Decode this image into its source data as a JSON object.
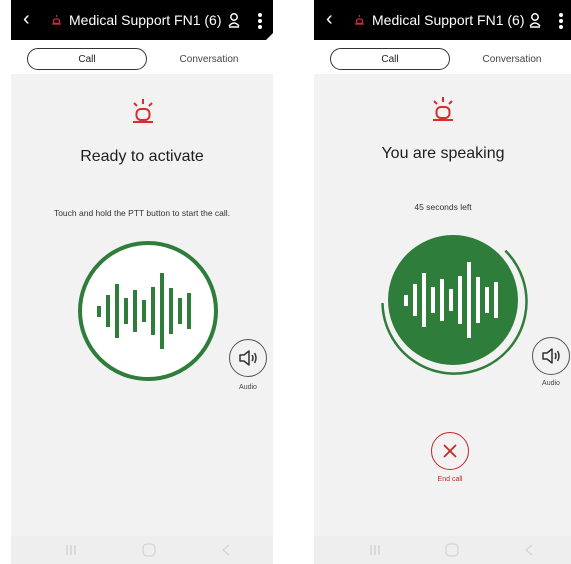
{
  "colors": {
    "accent_green": "#2e7d3a",
    "alert_red": "#d32f2f",
    "titlebar_bg": "#000000"
  },
  "left_screen": {
    "header": {
      "back_icon": "chevron-left-icon",
      "group_icon": "siren-icon",
      "title": "Medical Support FN1 (6)",
      "contact_icon": "contact-icon",
      "menu_icon": "more-vert-icon"
    },
    "tabs": [
      {
        "label": "Call",
        "active": true
      },
      {
        "label": "Conversation",
        "active": false
      }
    ],
    "status_icon": "siren-icon",
    "status_title": "Ready to activate",
    "hint": "Touch and hold the PTT button to start the call.",
    "ptt_button": {
      "icon": "waveform-icon",
      "state": "idle"
    },
    "audio": {
      "icon": "speaker-icon",
      "label": "Audio"
    },
    "navbar": [
      "recent-apps-icon",
      "home-icon",
      "back-icon"
    ]
  },
  "right_screen": {
    "header": {
      "back_icon": "chevron-left-icon",
      "group_icon": "siren-icon",
      "title": "Medical Support FN1 (6)",
      "contact_icon": "contact-icon",
      "menu_icon": "more-vert-icon"
    },
    "tabs": [
      {
        "label": "Call",
        "active": true
      },
      {
        "label": "Conversation",
        "active": false
      }
    ],
    "status_icon": "siren-icon",
    "status_title": "You are speaking",
    "timer": "45 seconds left",
    "ptt_button": {
      "icon": "waveform-icon",
      "state": "active"
    },
    "audio": {
      "icon": "speaker-icon",
      "label": "Audio"
    },
    "end_call": {
      "icon": "close-icon",
      "label": "End call"
    },
    "navbar": [
      "recent-apps-icon",
      "home-icon",
      "back-icon"
    ]
  }
}
